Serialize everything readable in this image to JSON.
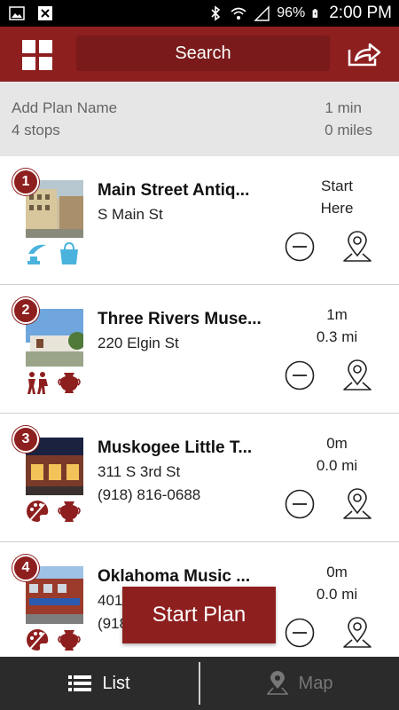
{
  "status_bar": {
    "battery": "96%",
    "time": "2:00 PM",
    "icons": [
      "image-icon",
      "close-box-icon",
      "bluetooth-icon",
      "wifi-icon",
      "signal-icon",
      "battery-icon"
    ]
  },
  "app_bar": {
    "search_label": "Search",
    "icons": [
      "grid-menu-icon",
      "share-icon"
    ],
    "brand_color": "#8e1f1f"
  },
  "plan": {
    "name_placeholder": "Add Plan Name",
    "stops": "4 stops",
    "total_time": "1 min",
    "total_distance": "0 miles"
  },
  "stops": [
    {
      "number": "1",
      "title": "Main Street Antiq...",
      "address": "S Main St",
      "phone": "",
      "meta_line1": "Start",
      "meta_line2": "Here",
      "categories": [
        "antiques-icon",
        "shopping-bag-icon"
      ]
    },
    {
      "number": "2",
      "title": "Three Rivers Muse...",
      "address": "220 Elgin St",
      "phone": "",
      "meta_line1": "1m",
      "meta_line2": "0.3 mi",
      "categories": [
        "people-icon",
        "urn-icon"
      ]
    },
    {
      "number": "3",
      "title": "Muskogee Little T...",
      "address": "311 S 3rd St",
      "phone": "(918) 816-0688",
      "meta_line1": "0m",
      "meta_line2": "0.0 mi",
      "categories": [
        "arts-palette-icon",
        "urn-icon"
      ]
    },
    {
      "number": "4",
      "title": "Oklahoma Music ...",
      "address": "401",
      "phone": "(918",
      "meta_line1": "0m",
      "meta_line2": "0.0 mi",
      "categories": [
        "arts-palette-icon",
        "urn-icon"
      ]
    }
  ],
  "start_plan_label": "Start Plan",
  "bottom_tabs": {
    "list_label": "List",
    "map_label": "Map"
  }
}
